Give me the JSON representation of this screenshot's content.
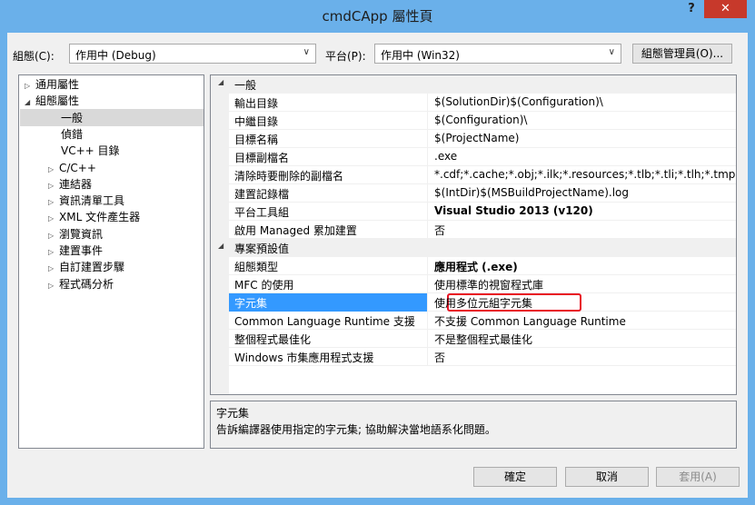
{
  "window": {
    "title": "cmdCApp 屬性頁",
    "help": "?",
    "close": "✕"
  },
  "config": {
    "label": "組態(C):",
    "value": "作用中 (Debug)",
    "platform_label": "平台(P):",
    "platform_value": "作用中 (Win32)",
    "manager_button": "組態管理員(O)..."
  },
  "tree": [
    {
      "label": "通用屬性",
      "expander": "▷",
      "level": 0
    },
    {
      "label": "組態屬性",
      "expander": "◢",
      "level": 0
    },
    {
      "label": "一般",
      "expander": "",
      "level": 1,
      "selected": true
    },
    {
      "label": "偵錯",
      "expander": "",
      "level": 1
    },
    {
      "label": "VC++ 目錄",
      "expander": "",
      "level": 1
    },
    {
      "label": "C/C++",
      "expander": "▷",
      "level": 1
    },
    {
      "label": "連結器",
      "expander": "▷",
      "level": 1
    },
    {
      "label": "資訊清單工具",
      "expander": "▷",
      "level": 1
    },
    {
      "label": "XML 文件產生器",
      "expander": "▷",
      "level": 1
    },
    {
      "label": "瀏覽資訊",
      "expander": "▷",
      "level": 1
    },
    {
      "label": "建置事件",
      "expander": "▷",
      "level": 1
    },
    {
      "label": "自訂建置步驟",
      "expander": "▷",
      "level": 1
    },
    {
      "label": "程式碼分析",
      "expander": "▷",
      "level": 1
    }
  ],
  "grid": {
    "general": {
      "title": "一般",
      "expander": "◢",
      "rows": [
        {
          "name": "輸出目錄",
          "value": "$(SolutionDir)$(Configuration)\\"
        },
        {
          "name": "中繼目錄",
          "value": "$(Configuration)\\"
        },
        {
          "name": "目標名稱",
          "value": "$(ProjectName)"
        },
        {
          "name": "目標副檔名",
          "value": ".exe"
        },
        {
          "name": "清除時要刪除的副檔名",
          "value": "*.cdf;*.cache;*.obj;*.ilk;*.resources;*.tlb;*.tli;*.tlh;*.tmp;*.rsp"
        },
        {
          "name": "建置記錄檔",
          "value": "$(IntDir)$(MSBuildProjectName).log"
        },
        {
          "name": "平台工具組",
          "value": "Visual Studio 2013 (v120)",
          "bold": true
        },
        {
          "name": "啟用 Managed 累加建置",
          "value": "否"
        }
      ]
    },
    "defaults": {
      "title": "專案預設值",
      "expander": "◢",
      "rows": [
        {
          "name": "組態類型",
          "value": "應用程式 (.exe)",
          "bold": true
        },
        {
          "name": "MFC 的使用",
          "value": "使用標準的視窗程式庫"
        },
        {
          "name": "字元集",
          "value": "使用多位元組字元集",
          "selected": true
        },
        {
          "name": "Common Language Runtime 支援",
          "value": "不支援 Common Language Runtime"
        },
        {
          "name": "整個程式最佳化",
          "value": "不是整個程式最佳化"
        },
        {
          "name": "Windows 市集應用程式支援",
          "value": "否"
        }
      ]
    }
  },
  "description": {
    "title": "字元集",
    "text": "告訴編譯器使用指定的字元集; 協助解決當地語系化問題。"
  },
  "buttons": {
    "ok": "確定",
    "cancel": "取消",
    "apply": "套用(A)"
  }
}
